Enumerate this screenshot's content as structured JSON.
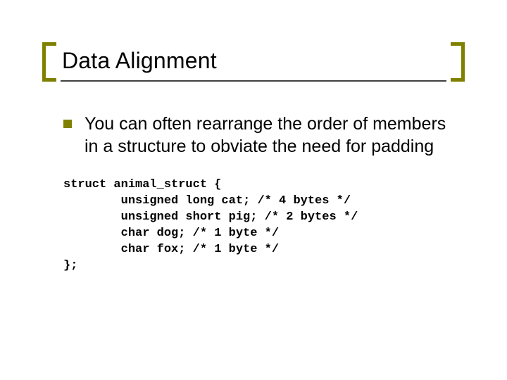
{
  "title": "Data Alignment",
  "bullets": [
    {
      "text": "You can often rearrange the order of members in a structure to obviate the need for padding"
    }
  ],
  "code": "struct animal_struct {\n        unsigned long cat; /* 4 bytes */\n        unsigned short pig; /* 2 bytes */\n        char dog; /* 1 byte */\n        char fox; /* 1 byte */\n};"
}
